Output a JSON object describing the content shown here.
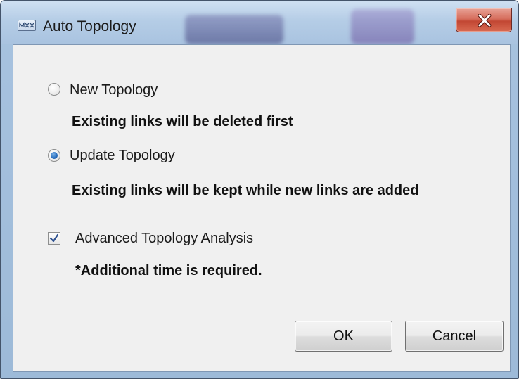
{
  "window": {
    "title": "Auto Topology",
    "app_icon": "mxview-app-icon",
    "close_icon": "close-x-icon"
  },
  "options": {
    "new_topology": {
      "label": "New Topology",
      "selected": false,
      "description": "Existing links will be deleted first"
    },
    "update_topology": {
      "label": "Update Topology",
      "selected": true,
      "description": "Existing links will be kept while new links are added"
    },
    "advanced_analysis": {
      "label": "Advanced Topology Analysis",
      "checked": true,
      "note": "*Additional time is required."
    }
  },
  "buttons": {
    "ok_label": "OK",
    "cancel_label": "Cancel"
  },
  "colors": {
    "accent_radio": "#2a6fbf",
    "close_button": "#c24733",
    "frame": "#a9c3e0"
  }
}
